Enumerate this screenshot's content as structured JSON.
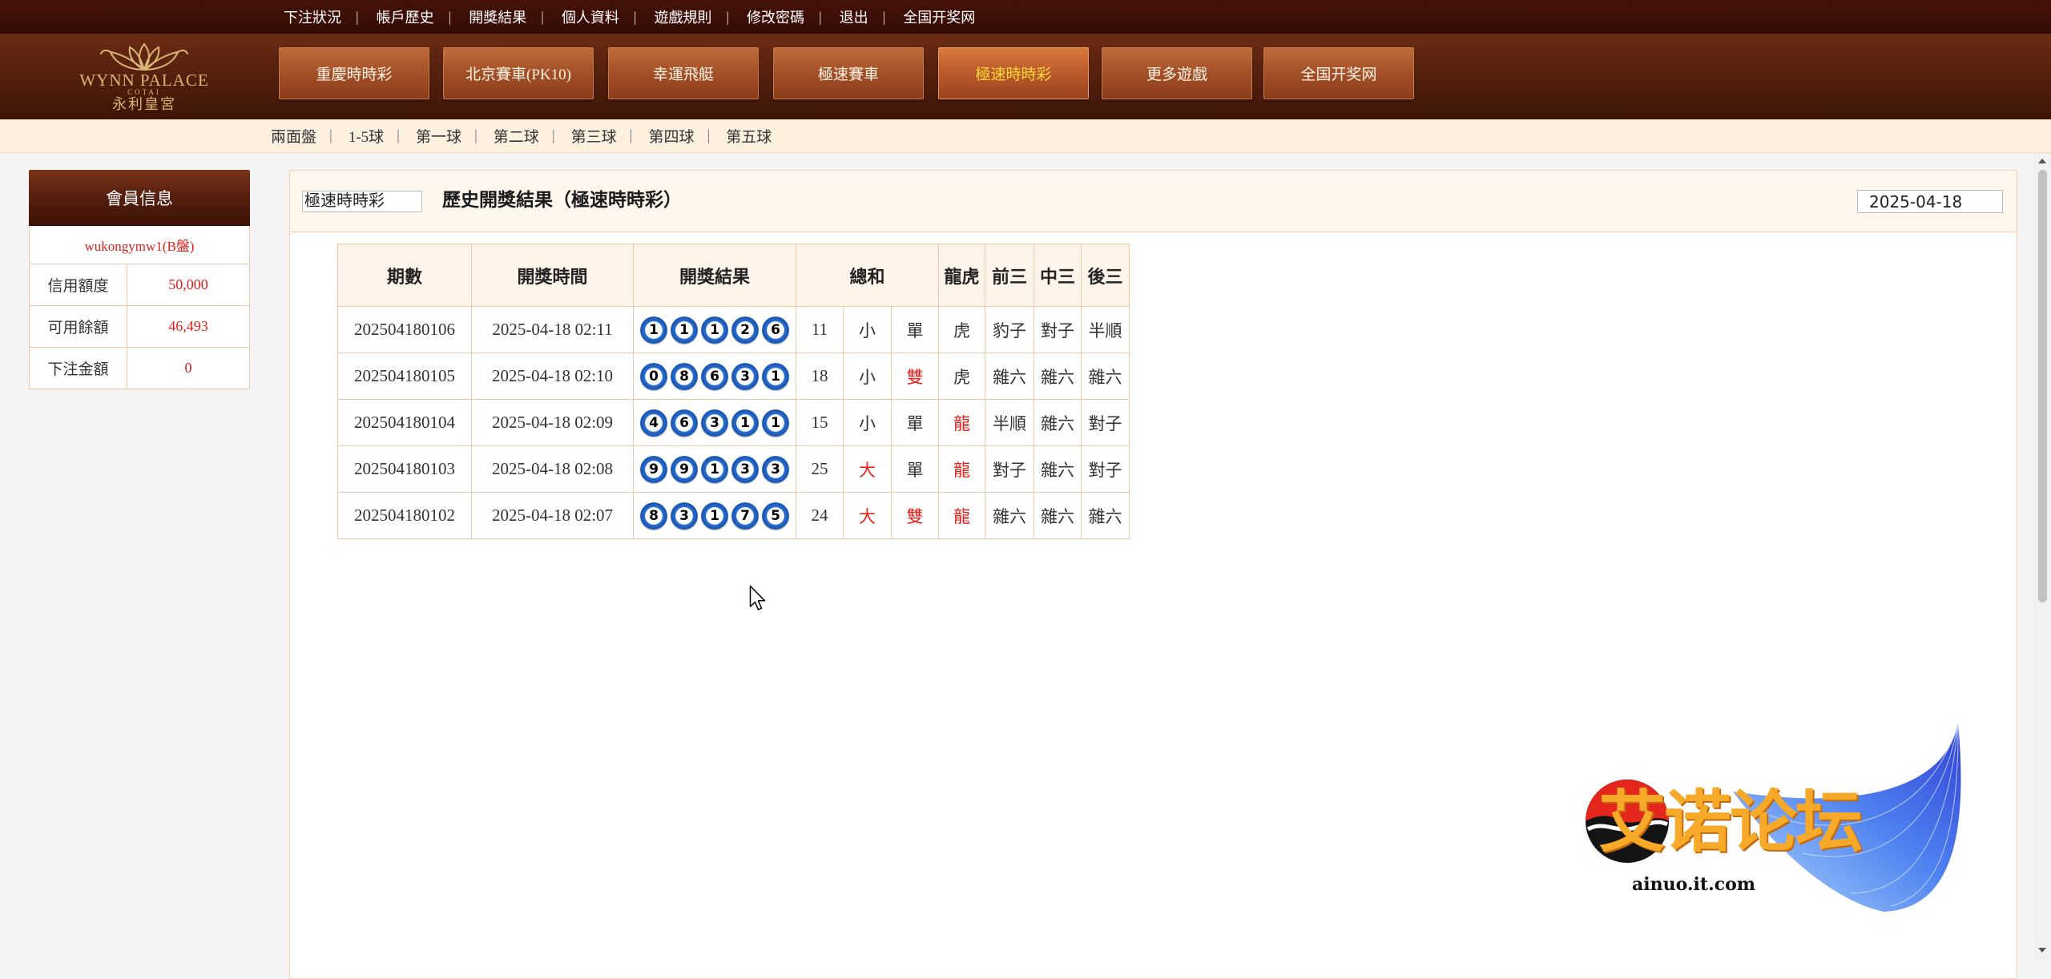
{
  "top_nav": {
    "separator": "|",
    "links": [
      "下注狀況",
      "帳戶歷史",
      "開獎結果",
      "個人資料",
      "遊戲規則",
      "修改密碼",
      "退出",
      "全国开奖网"
    ]
  },
  "logo": {
    "brand": "WYNN PALACE",
    "sub": "COTAI",
    "chinese": "永利皇宮"
  },
  "game_tabs": [
    {
      "label": "重慶時時彩"
    },
    {
      "label": "北京賽車(PK10)"
    },
    {
      "label": "幸運飛艇"
    },
    {
      "label": "極速賽車"
    },
    {
      "label": "極速時時彩",
      "active": true
    },
    {
      "label": "更多遊戲"
    },
    {
      "label": "全国开奖网"
    }
  ],
  "sub_nav": {
    "separator": "|",
    "items": [
      "兩面盤",
      "1-5球",
      "第一球",
      "第二球",
      "第三球",
      "第四球",
      "第五球"
    ]
  },
  "member_info": {
    "title": "會員信息",
    "account": "wukongymw1(B盤)",
    "rows": [
      {
        "label": "信用額度",
        "value": "50,000"
      },
      {
        "label": "可用餘額",
        "value": "46,493"
      },
      {
        "label": "下注金額",
        "value": "0"
      }
    ]
  },
  "results": {
    "game_select": "極速時時彩",
    "title": "歷史開獎結果（極速時時彩）",
    "date": "2025-04-18",
    "headers": {
      "issue": "期數",
      "time": "開獎時間",
      "result": "開獎結果",
      "sum": "總和",
      "dragon_tiger": "龍虎",
      "front3": "前三",
      "mid3": "中三",
      "back3": "後三"
    },
    "rows": [
      {
        "issue": "202504180106",
        "time": "2025-04-18 02:11",
        "balls": [
          1,
          1,
          1,
          2,
          6
        ],
        "sum": 11,
        "size": "小",
        "parity": "單",
        "dragon_tiger": "虎",
        "front3": "豹子",
        "mid3": "對子",
        "back3": "半順"
      },
      {
        "issue": "202504180105",
        "time": "2025-04-18 02:10",
        "balls": [
          0,
          8,
          6,
          3,
          1
        ],
        "sum": 18,
        "size": "小",
        "parity": "雙",
        "dragon_tiger": "虎",
        "front3": "雜六",
        "mid3": "雜六",
        "back3": "雜六"
      },
      {
        "issue": "202504180104",
        "time": "2025-04-18 02:09",
        "balls": [
          4,
          6,
          3,
          1,
          1
        ],
        "sum": 15,
        "size": "小",
        "parity": "單",
        "dragon_tiger": "龍",
        "front3": "半順",
        "mid3": "雜六",
        "back3": "對子"
      },
      {
        "issue": "202504180103",
        "time": "2025-04-18 02:08",
        "balls": [
          9,
          9,
          1,
          3,
          3
        ],
        "sum": 25,
        "size": "大",
        "parity": "單",
        "dragon_tiger": "龍",
        "front3": "對子",
        "mid3": "雜六",
        "back3": "對子"
      },
      {
        "issue": "202504180102",
        "time": "2025-04-18 02:07",
        "balls": [
          8,
          3,
          1,
          7,
          5
        ],
        "sum": 24,
        "size": "大",
        "parity": "雙",
        "dragon_tiger": "龍",
        "front3": "雜六",
        "mid3": "雜六",
        "back3": "雜六"
      }
    ]
  },
  "watermark": {
    "text": "艾诺论坛",
    "site": "ainuo.it.com"
  },
  "colors": {
    "top_bar": "#3c0e06",
    "header": "#57210e",
    "tab": "#a6522a",
    "tab_active_text": "#ffda3a",
    "sub_nav_bg": "#fdf0df",
    "border": "#f0c8a8",
    "highlight_red": "#e8211c",
    "ball_blue": "#1a55b0",
    "watermark_orange": "#f7a92a"
  }
}
